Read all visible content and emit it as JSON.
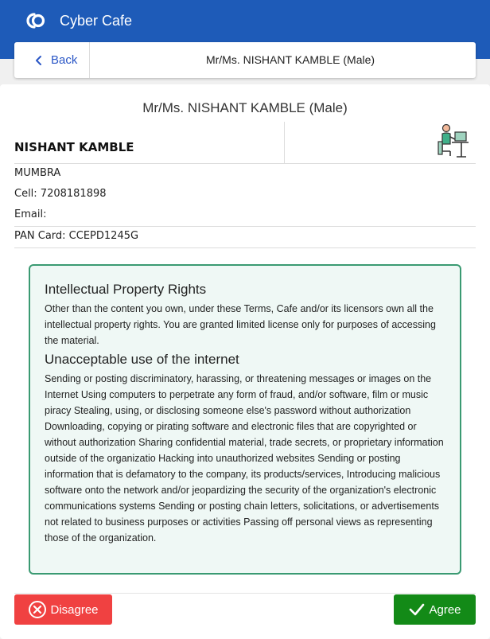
{
  "app": {
    "title": "Cyber Cafe",
    "logo_icon": "cc-logo-icon"
  },
  "nav": {
    "back_label": "Back",
    "title": "Mr/Ms. NISHANT KAMBLE (Male)"
  },
  "profile": {
    "heading": "Mr/Ms. NISHANT KAMBLE (Male)",
    "name": "NISHANT KAMBLE",
    "address": "MUMBRA",
    "cell": "Cell: 7208181898",
    "email": "Email:",
    "pan": "PAN Card: CCEPD1245G",
    "avatar_icon": "person-at-computer-icon"
  },
  "terms": {
    "section1_title": "Intellectual Property Rights",
    "section1_text": "Other than the content you own, under these Terms, Cafe and/or its licensors own all the intellectual property rights. You are granted limited license only for purposes of accessing the material.",
    "section2_title": "Unacceptable use of the internet",
    "section2_text": "Sending or posting discriminatory, harassing, or threatening messages or images on the Internet Using computers to perpetrate any form of fraud, and/or software, film or music piracy Stealing, using, or disclosing someone else's password without authorization Downloading, copying or pirating software and electronic files that are copyrighted or without authorization Sharing confidential material, trade secrets, or proprietary information outside of the organizatio Hacking into unauthorized websites Sending or posting information that is defamatory to the company, its products/services, Introducing malicious software onto the network and/or jeopardizing the security of the organization's electronic communications systems Sending or posting chain letters, solicitations, or advertisements not related to business purposes or activities Passing off personal views as representing those of the organization."
  },
  "actions": {
    "disagree_label": "Disagree",
    "agree_label": "Agree"
  },
  "colors": {
    "appbar": "#1e5bb8",
    "disagree": "#f04141",
    "agree": "#138a17",
    "terms_border": "#3a9a72"
  }
}
